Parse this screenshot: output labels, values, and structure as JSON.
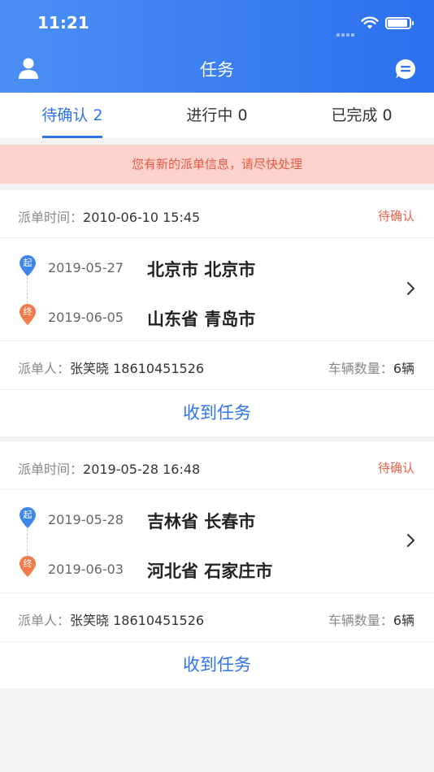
{
  "status_bar": {
    "time": "11:21"
  },
  "header": {
    "title": "任务"
  },
  "tabs": [
    {
      "label": "待确认 2",
      "active": true
    },
    {
      "label": "进行中 0",
      "active": false
    },
    {
      "label": "已完成 0",
      "active": false
    }
  ],
  "notice": "您有新的派单信息，请尽快处理",
  "labels": {
    "dispatch_time": "派单时间：",
    "sender": "派单人：",
    "vehicles": "车辆数量：",
    "start_pin": "起",
    "end_pin": "终"
  },
  "tasks": [
    {
      "dispatch_time": "2010-06-10 15:45",
      "status": "待确认",
      "start_date": "2019-05-27",
      "start_city": "北京市 北京市",
      "end_date": "2019-06-05",
      "end_city": "山东省 青岛市",
      "sender": "张笑晓 18610451526",
      "vehicles": "6辆",
      "action": "收到任务"
    },
    {
      "dispatch_time": "2019-05-28 16:48",
      "status": "待确认",
      "start_date": "2019-05-28",
      "start_city": "吉林省 长春市",
      "end_date": "2019-06-03",
      "end_city": "河北省 石家庄市",
      "sender": "张笑晓 18610451526",
      "vehicles": "6辆",
      "action": "收到任务"
    }
  ],
  "colors": {
    "header_start": "#4b8ff5",
    "header_end": "#2b70ee",
    "accent": "#2f74ea",
    "status": "#e8624a",
    "notice_bg": "#fbd2cc",
    "start_pin": "#3f86e9",
    "end_pin": "#f07b4c"
  }
}
